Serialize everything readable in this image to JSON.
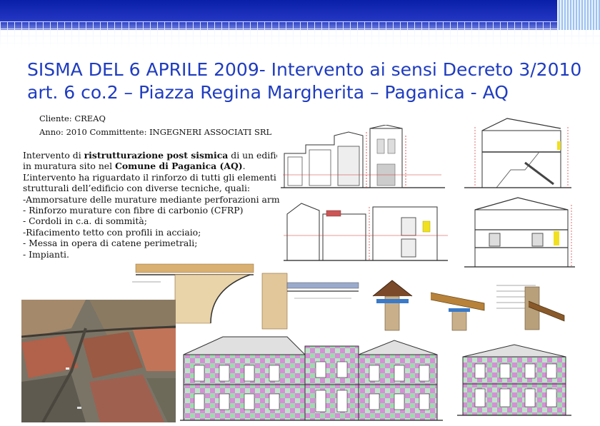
{
  "title": {
    "line1": "SISMA DEL 6 APRILE 2009- Intervento ai sensi Decreto 3/2010",
    "line2": "art. 6 co.2 – Piazza Regina Margherita – Paganica - AQ"
  },
  "info": {
    "client": "Cliente:  CREAQ",
    "year": "Anno: 2010  Committente: INGEGNERI ASSOCIATI SRL"
  },
  "description": {
    "intro_a": "Intervento di ",
    "intro_b": "ristrutturazione post sismica",
    "intro_c": " di un edificio",
    "line2_a": "in muratura sito nel ",
    "line2_b": "Comune di Paganica (AQ)",
    "line2_c": ".",
    "line3": "L’intervento ha riguardato il rinforzo di tutti gli elementi",
    "line4": "strutturali dell’edificio con diverse tecniche, quali:",
    "items": [
      "-Ammorsature delle murature mediante perforazioni armate;",
      "- Rinforzo murature con fibre di carbonio (CFRP)",
      "- Cordoli in c.a. di sommità;",
      "-Rifacimento tetto con profili in acciaio;",
      "- Messa in opera di catene perimetrali;",
      "- Impianti."
    ]
  },
  "colors": {
    "title": "#1f3cc0",
    "topbar": "#0a1fa8",
    "facade_pink": "#d68fd6",
    "facade_green": "#9fd9b0",
    "section_red": "#d83030",
    "section_yellow": "#f0e020"
  }
}
